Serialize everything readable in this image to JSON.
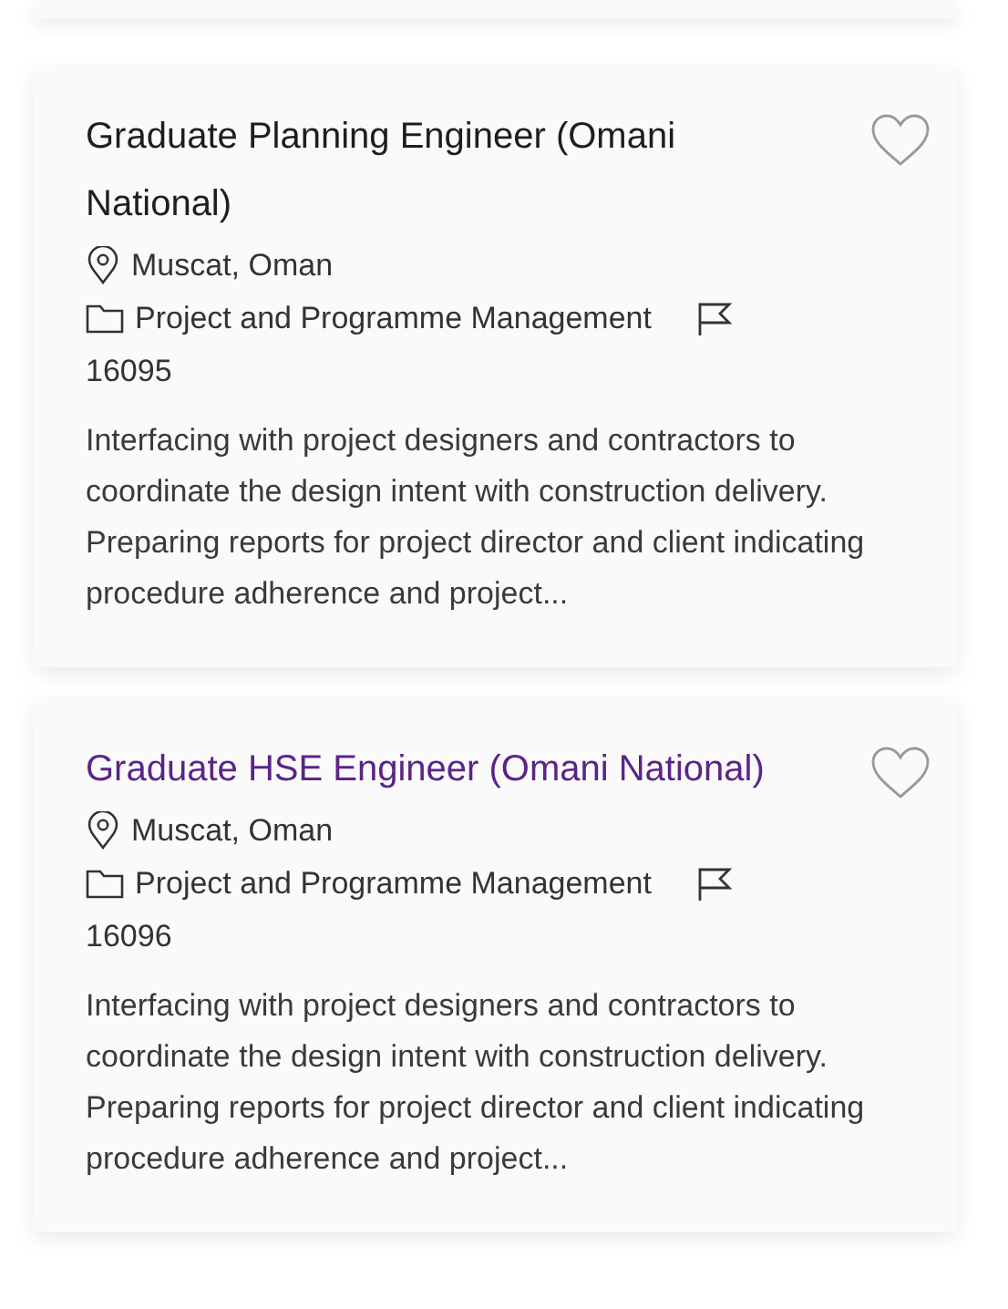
{
  "jobs": [
    {
      "title": "Graduate Planning Engineer (Omani National)",
      "visited": false,
      "favorite": false,
      "location": "Muscat, Oman",
      "category": "Project and Programme Management",
      "reference": "16095",
      "description": "Interfacing with project designers and contractors to coordinate the design intent with construction delivery. Preparing reports for project director and client indicating procedure adherence and project..."
    },
    {
      "title": "Graduate HSE Engineer (Omani National)",
      "visited": true,
      "favorite": false,
      "location": "Muscat, Oman",
      "category": "Project and Programme Management",
      "reference": "16096",
      "description": "Interfacing with project designers and contractors to coordinate the design intent with construction delivery. Preparing reports for project director and client indicating procedure adherence and project..."
    }
  ]
}
